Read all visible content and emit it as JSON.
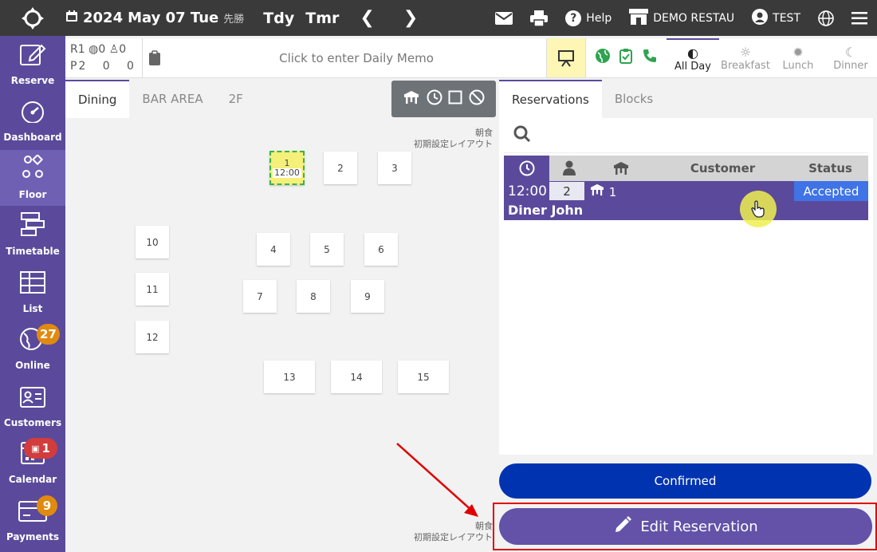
{
  "topbar": {
    "year": "2024",
    "date": "May 07 Tue",
    "rokuyo": "先勝",
    "today_label": "Tdy",
    "tomorrow_label": "Tmr",
    "help_label": "Help",
    "restaurant_label": "DEMO RESTAU",
    "user_label": "TEST"
  },
  "sidebar": {
    "items": [
      {
        "label": "Reserve",
        "icon": "edit-icon"
      },
      {
        "label": "Dashboard",
        "icon": "gauge-icon"
      },
      {
        "label": "Floor",
        "icon": "shapes-icon"
      },
      {
        "label": "Timetable",
        "icon": "timetable-icon"
      },
      {
        "label": "List",
        "icon": "table-icon"
      },
      {
        "label": "Online",
        "icon": "globe-icon",
        "badge": "27"
      },
      {
        "label": "Customers",
        "icon": "id-card-icon"
      },
      {
        "label": "Calendar",
        "icon": "calendar-icon",
        "badge": "1"
      },
      {
        "label": "Payments",
        "icon": "card-icon",
        "badge": "9"
      }
    ]
  },
  "infobar": {
    "r_row": [
      "R",
      "1",
      "0",
      "0"
    ],
    "p_row": [
      "P",
      "2",
      "0",
      "0"
    ],
    "memo_placeholder": "Click to enter Daily Memo",
    "meals": [
      "All Day",
      "Breakfast",
      "Lunch",
      "Dinner"
    ],
    "active_meal": "All Day"
  },
  "floor": {
    "tabs": [
      "Dining",
      "BAR AREA",
      "2F"
    ],
    "active_tab": "Dining",
    "layout_label_top": [
      "朝食",
      "初期設定レイアウト"
    ],
    "layout_label_bottom": [
      "朝食",
      "初期設定レイアウト"
    ],
    "tables": [
      {
        "id": "1",
        "time": "12:00"
      },
      {
        "id": "2"
      },
      {
        "id": "3"
      },
      {
        "id": "10"
      },
      {
        "id": "4"
      },
      {
        "id": "5"
      },
      {
        "id": "6"
      },
      {
        "id": "11"
      },
      {
        "id": "7"
      },
      {
        "id": "8"
      },
      {
        "id": "9"
      },
      {
        "id": "12"
      },
      {
        "id": "13"
      },
      {
        "id": "14"
      },
      {
        "id": "15"
      }
    ]
  },
  "reservations": {
    "tabs": [
      "Reservations",
      "Blocks"
    ],
    "active_tab": "Reservations",
    "headers": {
      "customer": "Customer",
      "status": "Status"
    },
    "rows": [
      {
        "time": "12:00",
        "guests": "2",
        "table": "1",
        "status": "Accepted",
        "name": "Diner John"
      }
    ]
  },
  "buttons": {
    "confirmed": "Confirmed",
    "edit_reservation": "Edit Reservation"
  },
  "colors": {
    "brand_purple": "#5b4a9b",
    "confirmed_blue": "#0033b0",
    "accepted_blue": "#3f73e6",
    "highlight_red": "#e00000"
  }
}
